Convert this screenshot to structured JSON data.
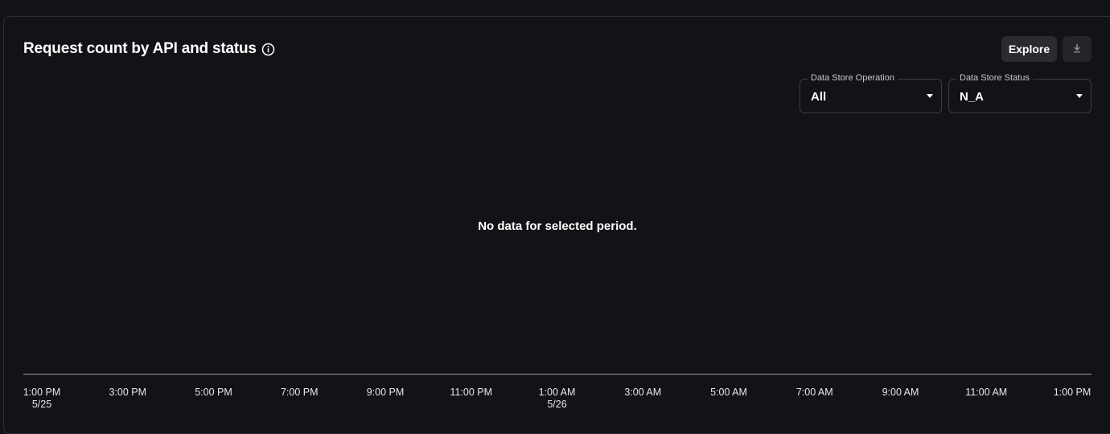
{
  "panel": {
    "title": "Request count by API and status",
    "explore_label": "Explore"
  },
  "filters": [
    {
      "label": "Data Store Operation",
      "value": "All"
    },
    {
      "label": "Data Store Status",
      "value": "N_A"
    }
  ],
  "empty_message": "No data for selected period.",
  "x_axis": {
    "ticks": [
      {
        "time": "1:00 PM",
        "date": "5/25"
      },
      {
        "time": "3:00 PM",
        "date": ""
      },
      {
        "time": "5:00 PM",
        "date": ""
      },
      {
        "time": "7:00 PM",
        "date": ""
      },
      {
        "time": "9:00 PM",
        "date": ""
      },
      {
        "time": "11:00 PM",
        "date": ""
      },
      {
        "time": "1:00 AM",
        "date": "5/26"
      },
      {
        "time": "3:00 AM",
        "date": ""
      },
      {
        "time": "5:00 AM",
        "date": ""
      },
      {
        "time": "7:00 AM",
        "date": ""
      },
      {
        "time": "9:00 AM",
        "date": ""
      },
      {
        "time": "11:00 AM",
        "date": ""
      },
      {
        "time": "1:00 PM",
        "date": ""
      }
    ]
  },
  "icons": {
    "info": "info-circle-icon",
    "download": "download-icon",
    "caret": "caret-down-icon"
  }
}
